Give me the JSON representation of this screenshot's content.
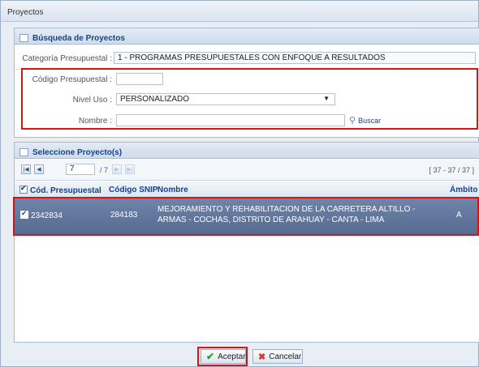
{
  "window": {
    "title": "Proyectos"
  },
  "search_panel": {
    "header": "Búsqueda de Proyectos",
    "categoria": {
      "label": "Categoría Presupuestal :",
      "value": "1 - PROGRAMAS PRESUPUESTALES CON ENFOQUE A RESULTADOS"
    },
    "codigo": {
      "label": "Código Presupuestal :",
      "value": ""
    },
    "nivel": {
      "label": "Nivel Uso :",
      "value": "PERSONALIZADO"
    },
    "nombre": {
      "label": "Nombre :",
      "value": ""
    },
    "buscar_label": "Buscar"
  },
  "results_panel": {
    "header": "Seleccione Proyecto(s)",
    "pager": {
      "page": "7",
      "total": "/ 7",
      "range": "[ 37 - 37 / 37 ]"
    },
    "columns": [
      "Cód. Presupuestal",
      "Código SNIP",
      "Nombre",
      "Ámbito"
    ],
    "rows": [
      {
        "cod": "2342834",
        "snip": "284183",
        "nombre": "MEJORAMIENTO Y REHABILITACION DE LA CARRETERA ALTILLO - ARMAS - COCHAS, DISTRITO DE ARAHUAY - CANTA - LIMA",
        "ambito": "A"
      }
    ]
  },
  "footer": {
    "accept_label": "Aceptar",
    "cancel_label": "Cancelar"
  }
}
